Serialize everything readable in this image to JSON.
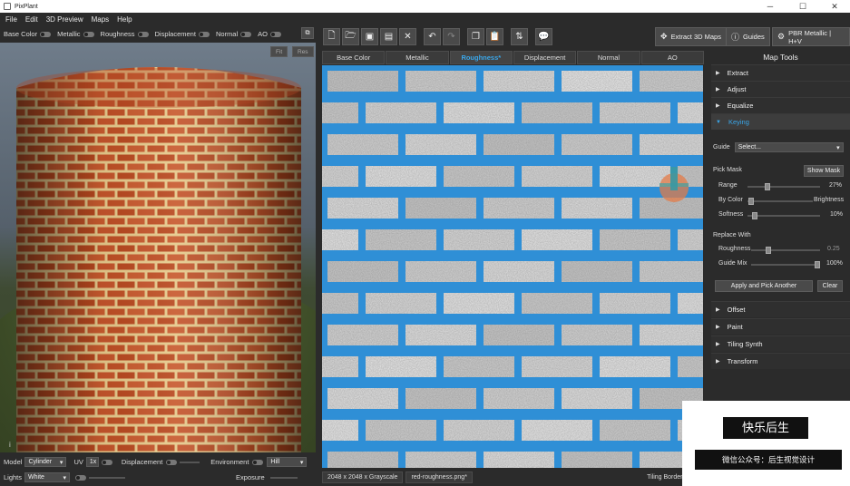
{
  "window": {
    "title": "PixPlant",
    "controls": {
      "minimize": "─",
      "maximize": "☐",
      "close": "✕"
    }
  },
  "menu": [
    "File",
    "Edit",
    "3D Preview",
    "Maps",
    "Help"
  ],
  "channels": [
    "Base Color",
    "Metallic",
    "Roughness",
    "Displacement",
    "Normal",
    "AO"
  ],
  "viewport": {
    "fit_label": "Fit",
    "res_label": "Res",
    "info": "i"
  },
  "bottom": {
    "model_label": "Model",
    "model_value": "Cylinder",
    "uv_label": "UV",
    "uv_value": "1x",
    "displacement_label": "Displacement",
    "environment_label": "Environment",
    "environment_value": "Hill",
    "lights_label": "Lights",
    "lights_value": "White",
    "exposure_label": "Exposure"
  },
  "toolbar_right": {
    "extract_label": "Extract 3D Maps",
    "guides_label": "Guides",
    "pbr_label": "PBR Metallic | H+V"
  },
  "tabs": [
    "Base Color",
    "Metallic",
    "Roughness*",
    "Displacement",
    "Normal",
    "AO"
  ],
  "active_tab": 2,
  "status": {
    "size": "2048 x 2048 x Grayscale",
    "file": "red-roughness.png*",
    "tiling": "Tiling Borders"
  },
  "panel": {
    "title": "Map Tools",
    "sections_top": [
      "Extract",
      "Adjust",
      "Equalize"
    ],
    "keying_label": "Keying",
    "guide_label": "Guide",
    "guide_value": "Select...",
    "pick_mask_label": "Pick Mask",
    "show_mask_label": "Show Mask",
    "range_label": "Range",
    "range_value": "27%",
    "range_level": 0.27,
    "bycolor_label": "By Color",
    "brightness_label": "Brightness",
    "bycolor_level": 0.05,
    "softness_label": "Softness",
    "softness_value": "10%",
    "softness_level": 0.1,
    "replace_label": "Replace With",
    "roughness_label": "Roughness",
    "roughness_value": "0.25",
    "roughness_level": 0.25,
    "guidemix_label": "Guide Mix",
    "guidemix_value": "100%",
    "guidemix_level": 1.0,
    "apply_label": "Apply and Pick Another",
    "clear_label": "Clear",
    "sections_bottom": [
      "Offset",
      "Paint",
      "Tiling Synth",
      "Transform"
    ]
  },
  "watermark": {
    "title": "快乐后生",
    "subtitle": "微信公众号：后生视觉设计"
  },
  "colors": {
    "accent": "#3aa6e8",
    "mortar_blue": "#2f8fd6",
    "brick": "#c4542b",
    "mortar": "#e6c98b"
  }
}
